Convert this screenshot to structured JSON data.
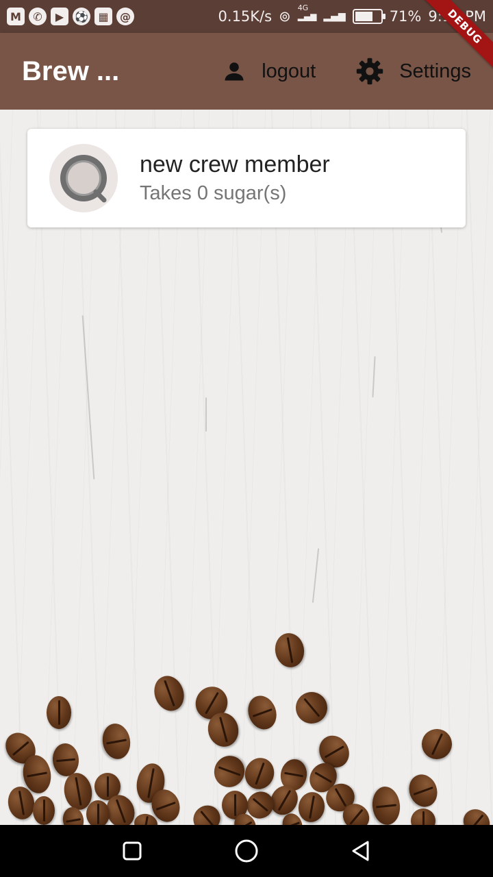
{
  "status_bar": {
    "net_speed": "0.15K/s",
    "network_type": "4G",
    "battery_percent": "71%",
    "battery_level": 0.71,
    "time": "9:10 PM",
    "notification_icons": [
      "gmail-icon",
      "whatsapp-icon",
      "youtube-icon",
      "soccer-icon",
      "calendar-icon",
      "sync-icon"
    ]
  },
  "debug_banner": "DEBUG",
  "app_bar": {
    "title": "Brew ...",
    "actions": [
      {
        "label": "logout",
        "icon": "person-icon"
      },
      {
        "label": "Settings",
        "icon": "gear-icon"
      }
    ],
    "color": "#795548"
  },
  "brews": [
    {
      "name": "new crew member",
      "subtitle": "Takes 0 sugar(s)",
      "icon": "coffee-cup-icon"
    }
  ],
  "nav_bar": {
    "buttons": [
      "recents-button",
      "home-button",
      "back-button"
    ]
  }
}
